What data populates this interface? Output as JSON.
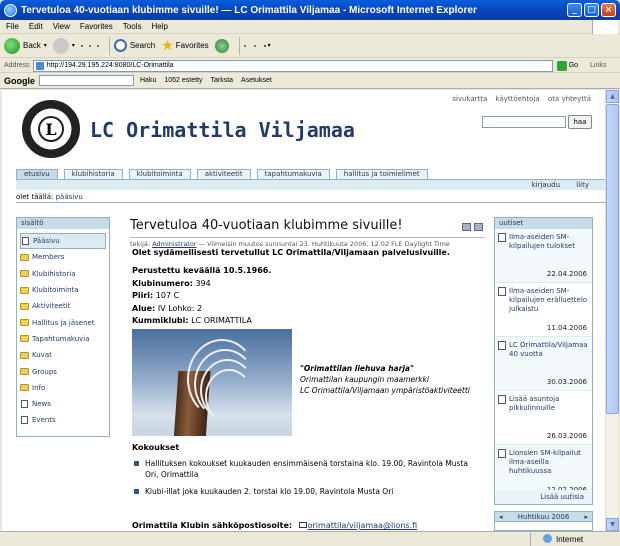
{
  "window": {
    "title": "Tervetuloa 40-vuotiaan klubimme sivuille! — LC Orimattila Viljamaa - Microsoft Internet Explorer"
  },
  "menu": [
    "File",
    "Edit",
    "View",
    "Favorites",
    "Tools",
    "Help"
  ],
  "toolbar": {
    "back": "Back",
    "search": "Search",
    "favorites": "Favorites"
  },
  "address": {
    "label": "Address",
    "url": "http://194.29.195.224:8080/LC-Orimattila",
    "go": "Go",
    "links": "Links"
  },
  "google_bar": {
    "logo": "Google",
    "search": "Haku",
    "blocked": "1052 estetty",
    "spell": "Tarksta",
    "settings": "Asetukset"
  },
  "site": {
    "top_links": [
      "sivukartta",
      "käyttöehtoja",
      "ota yhteyttä"
    ],
    "title": "LC Orimattila Viljamaa",
    "search_button": "haa",
    "logo_letter": "L",
    "tabs": [
      "etusivu",
      "klubihistoria",
      "klubitoiminta",
      "aktiviteetit",
      "tapahtumakuvia",
      "hallitus ja toimielimet"
    ],
    "subnav": [
      "kirjaudu",
      "liity"
    ],
    "breadcrumb_label": "olet täällä:",
    "breadcrumb_current": "pääsivu"
  },
  "left_nav": {
    "header": "sisältö",
    "items": [
      "Pääsivu",
      "Members",
      "Klubihistoria",
      "Klubitoiminta",
      "Aktiviteetit",
      "Hallitus ja jäsenet",
      "Tapahtumakuvia",
      "Kuvat",
      "Groups",
      "Info",
      "News",
      "Events"
    ]
  },
  "article": {
    "title": "Tervetuloa 40-vuotiaan klubimme sivuille!",
    "meta_by": "tekijä:",
    "meta_author": "Administrator",
    "meta_rest": "— Viimeisin muutos sunnuntai 23. Huhtikuuta 2006, 12.02 FLE Daylight Time",
    "intro": "Olet sydämellisesti tervetullut LC Orimattila/Viljamaan palvelusivuille.",
    "founded": "Perustettu keväällä 10.5.1966.",
    "facts": [
      {
        "label": "Klubinumero:",
        "value": "394"
      },
      {
        "label": "Piiri:",
        "value": "107 C"
      },
      {
        "label": "Alue:",
        "value": "IV Lohko: 2"
      },
      {
        "label": "Kummiklubi:",
        "value": "LC ORIMATTILA"
      }
    ],
    "caption_title": "\"Orimattilan liehuva harja\"",
    "caption_line1": "Orimattilan kaupungin maamerkki",
    "caption_line2": "LC Orimattila/Viljamaan ympäristöaktiviteetti",
    "meetings_heading": "Kokoukset",
    "meetings": [
      "Hallituksen kokoukset kuukauden ensimmäisenä torstaina klo. 19.00, Ravintola Musta Ori, Orimattila",
      "Klubi-illat joka kuukauden 2. torstai klo 19.00, Ravintola Musta Ori"
    ],
    "email_label": "Orimattila Klubin sähköpostiosoite:",
    "email": "orimattila/viljamaa@lions.fi"
  },
  "news": {
    "header": "uutiset",
    "items": [
      {
        "title": "Ilma-aseiden SM-kilpailujen tulokset",
        "date": "22.04.2006"
      },
      {
        "title": "Ilma-aseiden SM-kilpailujen erälluettelo julkaistu",
        "date": "11.04.2006"
      },
      {
        "title": "LC Orimattila/Viljamaa 40 vuotta",
        "date": "30.03.2006"
      },
      {
        "title": "Lisää asuntoja pikkulinnuille",
        "date": "26.03.2006"
      },
      {
        "title": "Lionsien SM-kilpailut ilma-aseilla huhtikuussa",
        "date": "12.02.2006"
      }
    ],
    "more": "Lisää uutisia"
  },
  "calendar": {
    "prev": "◂",
    "month": "Huhtikuu 2006",
    "next": "▸"
  },
  "status": {
    "done": "",
    "zone": "Internet"
  }
}
